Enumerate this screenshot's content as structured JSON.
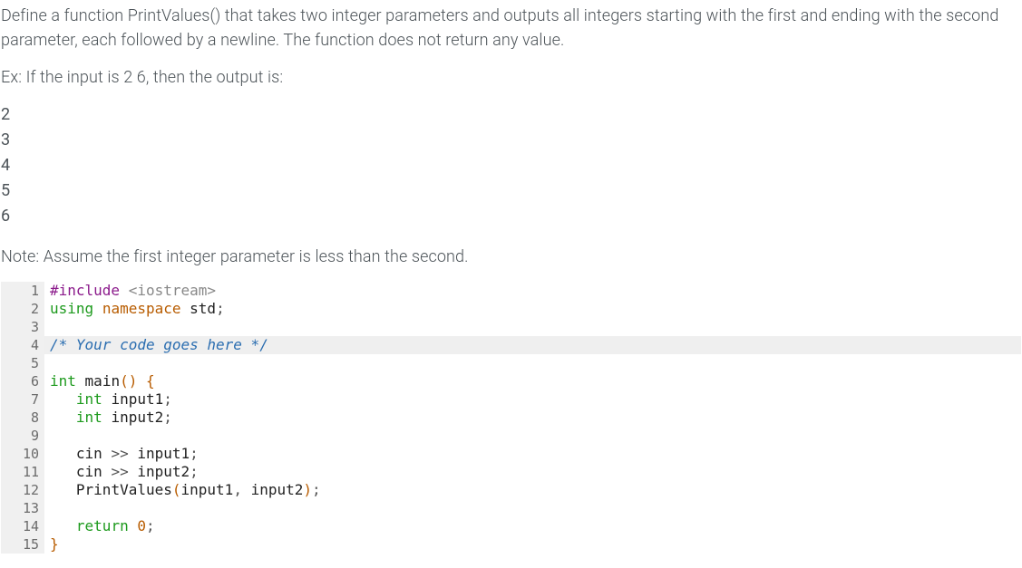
{
  "prompt": {
    "description": "Define a function PrintValues() that takes two integer parameters and outputs all integers starting with the first and ending with the second parameter, each followed by a newline. The function does not return any value.",
    "example_intro": "Ex: If the input is 2 6, then the output is:",
    "example_output": [
      "2",
      "3",
      "4",
      "5",
      "6"
    ],
    "note": "Note: Assume the first integer parameter is less than the second."
  },
  "code": {
    "highlight_line": 4,
    "lines": [
      {
        "n": 1,
        "tokens": [
          [
            "pp",
            "#include"
          ],
          [
            "plain",
            " "
          ],
          [
            "str",
            "<iostream>"
          ]
        ]
      },
      {
        "n": 2,
        "tokens": [
          [
            "kw",
            "using"
          ],
          [
            "plain",
            " "
          ],
          [
            "ns",
            "namespace"
          ],
          [
            "plain",
            " "
          ],
          [
            "ident",
            "std"
          ],
          [
            "punct",
            ";"
          ]
        ]
      },
      {
        "n": 3,
        "tokens": []
      },
      {
        "n": 4,
        "tokens": [
          [
            "comment",
            "/* Your code goes here */"
          ]
        ]
      },
      {
        "n": 5,
        "tokens": []
      },
      {
        "n": 6,
        "tokens": [
          [
            "kw",
            "int"
          ],
          [
            "plain",
            " "
          ],
          [
            "ident",
            "main"
          ],
          [
            "paren",
            "()"
          ],
          [
            "plain",
            " "
          ],
          [
            "brace",
            "{"
          ]
        ]
      },
      {
        "n": 7,
        "tokens": [
          [
            "plain",
            "   "
          ],
          [
            "kw",
            "int"
          ],
          [
            "plain",
            " "
          ],
          [
            "ident",
            "input1"
          ],
          [
            "punct",
            ";"
          ]
        ]
      },
      {
        "n": 8,
        "tokens": [
          [
            "plain",
            "   "
          ],
          [
            "kw",
            "int"
          ],
          [
            "plain",
            " "
          ],
          [
            "ident",
            "input2"
          ],
          [
            "punct",
            ";"
          ]
        ]
      },
      {
        "n": 9,
        "tokens": []
      },
      {
        "n": 10,
        "tokens": [
          [
            "plain",
            "   "
          ],
          [
            "ident",
            "cin"
          ],
          [
            "plain",
            " "
          ],
          [
            "punct",
            ">>"
          ],
          [
            "plain",
            " "
          ],
          [
            "ident",
            "input1"
          ],
          [
            "punct",
            ";"
          ]
        ]
      },
      {
        "n": 11,
        "tokens": [
          [
            "plain",
            "   "
          ],
          [
            "ident",
            "cin"
          ],
          [
            "plain",
            " "
          ],
          [
            "punct",
            ">>"
          ],
          [
            "plain",
            " "
          ],
          [
            "ident",
            "input2"
          ],
          [
            "punct",
            ";"
          ]
        ]
      },
      {
        "n": 12,
        "tokens": [
          [
            "plain",
            "   "
          ],
          [
            "ident",
            "PrintValues"
          ],
          [
            "paren",
            "("
          ],
          [
            "ident",
            "input1"
          ],
          [
            "punct",
            ","
          ],
          [
            "plain",
            " "
          ],
          [
            "ident",
            "input2"
          ],
          [
            "paren",
            ")"
          ],
          [
            "punct",
            ";"
          ]
        ]
      },
      {
        "n": 13,
        "tokens": []
      },
      {
        "n": 14,
        "tokens": [
          [
            "plain",
            "   "
          ],
          [
            "kw",
            "return"
          ],
          [
            "plain",
            " "
          ],
          [
            "num",
            "0"
          ],
          [
            "punct",
            ";"
          ]
        ]
      },
      {
        "n": 15,
        "tokens": [
          [
            "brace",
            "}"
          ]
        ]
      }
    ]
  }
}
